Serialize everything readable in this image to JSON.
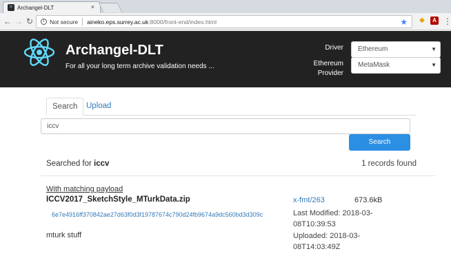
{
  "browser": {
    "tab_title": "Archangel-DLT",
    "tab_close": "×",
    "security_label": "Not secure",
    "url_host": "aineko.eps.surrey.ac.uk",
    "url_path": ":8000/front-end/index.html"
  },
  "header": {
    "title": "Archangel-DLT",
    "tagline": "For all your long term archive validation needs ...",
    "driver_label": "Driver",
    "driver_value": "Ethereum",
    "provider_label_line1": "Ethereum",
    "provider_label_line2": "Provider",
    "provider_value": "MetaMask"
  },
  "tabs": {
    "search": "Search",
    "upload": "Upload"
  },
  "search": {
    "query": "iccv",
    "button": "Search",
    "searched_prefix": "Searched for ",
    "searched_term": "iccv",
    "records_found": "1 records found"
  },
  "result": {
    "match_label": "With matching payload",
    "filename": "ICCV2017_SketchStyle_MTurkData.zip",
    "hash": "6e7e4916ff370842ae27d63f0d3f19787674c790d24fb9674a9dc560bd3d309c",
    "description": "mturk stuff",
    "format": "x-fmt/263",
    "size": "673.6kB",
    "last_modified": "Last Modified: 2018-03-08T10:39:53",
    "uploaded": "Uploaded: 2018-03-08T14:03:49Z"
  },
  "colors": {
    "header_bg": "#222222",
    "primary": "#2b8fe3",
    "link": "#337ab7"
  }
}
